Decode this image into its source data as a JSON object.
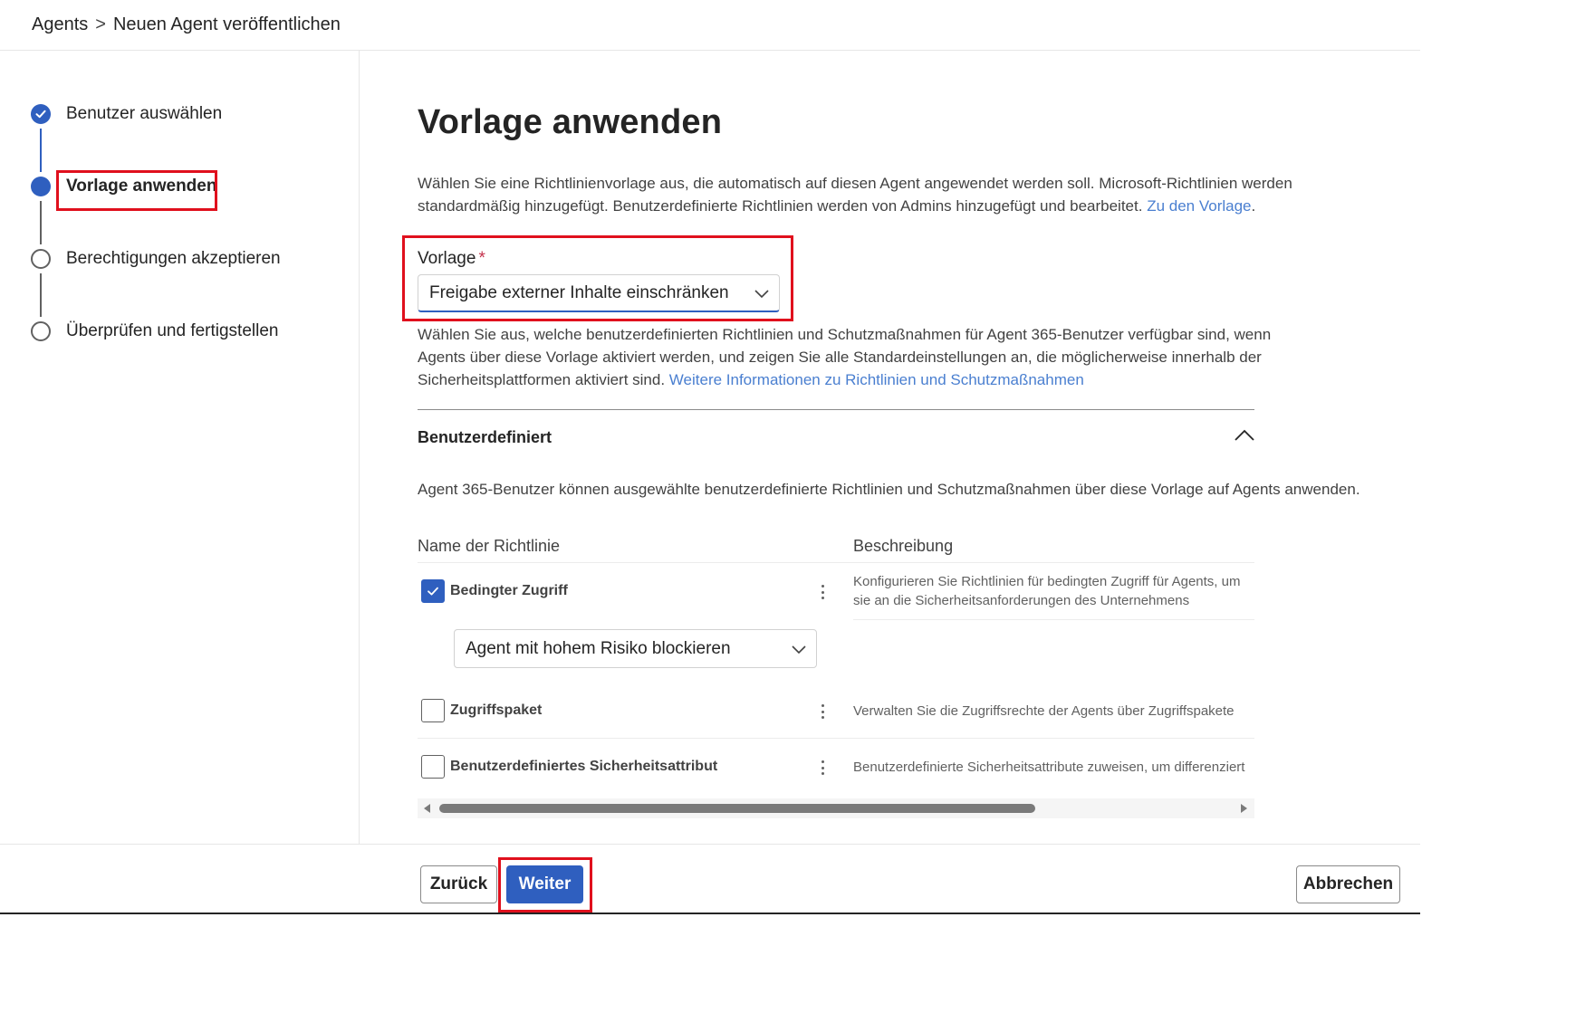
{
  "breadcrumb": {
    "root": "Agents",
    "separator": ">",
    "current": "Neuen Agent veröffentlichen"
  },
  "steps": [
    {
      "label": "Benutzer auswählen",
      "state": "done"
    },
    {
      "label": "Vorlage anwenden",
      "state": "current"
    },
    {
      "label": "Berechtigungen akzeptieren",
      "state": "todo"
    },
    {
      "label": "Überprüfen und fertigstellen",
      "state": "todo"
    }
  ],
  "main": {
    "title": "Vorlage anwenden",
    "intro": "Wählen Sie eine Richtlinienvorlage aus, die automatisch auf diesen Agent angewendet werden soll. Microsoft-Richtlinien werden standardmäßig hinzugefügt. Benutzerdefinierte Richtlinien werden von Admins hinzugefügt und bearbeitet.",
    "intro_link": "Zu den Vorlage",
    "intro_end": ".",
    "template_label": "Vorlage",
    "template_required": "*",
    "template_value": "Freigabe externer Inhalte einschränken",
    "template_help": "Wählen Sie aus, welche benutzerdefinierten Richtlinien und Schutzmaßnahmen für Agent 365-Benutzer verfügbar sind, wenn Agents über diese Vorlage aktiviert werden, und zeigen Sie alle Standardeinstellungen an, die möglicherweise innerhalb der Sicherheitsplattformen aktiviert sind.",
    "template_help_link": "Weitere Informationen zu Richtlinien und Schutzmaßnahmen",
    "section_title": "Benutzerdefiniert",
    "section_desc": "Agent 365-Benutzer können ausgewählte benutzerdefinierte Richtlinien und Schutzmaßnahmen über diese Vorlage auf Agents anwenden.",
    "columns": {
      "name": "Name der Richtlinie",
      "description": "Beschreibung"
    },
    "policies": [
      {
        "name": "Bedingter Zugriff",
        "checked": true,
        "description": "Konfigurieren Sie Richtlinien für bedingten Zugriff für Agents, um sie an die Sicherheitsanforderungen des Unternehmens auszurichten.",
        "sub_select": "Agent mit hohem Risiko blockieren"
      },
      {
        "name": "Zugriffspaket",
        "checked": false,
        "description": "Verwalten Sie die Zugriffsrechte der Agents über Zugriffspakete"
      },
      {
        "name": "Benutzerdefiniertes Sicherheitsattribut",
        "checked": false,
        "description": "Benutzerdefinierte Sicherheitsattribute zuweisen, um differenziert"
      }
    ]
  },
  "footer": {
    "back": "Zurück",
    "next": "Weiter",
    "cancel": "Abbrechen"
  },
  "colors": {
    "accent": "#2f5fbf",
    "link": "#4a7fd0",
    "highlight": "#e0101d",
    "required": "#c4314b"
  }
}
